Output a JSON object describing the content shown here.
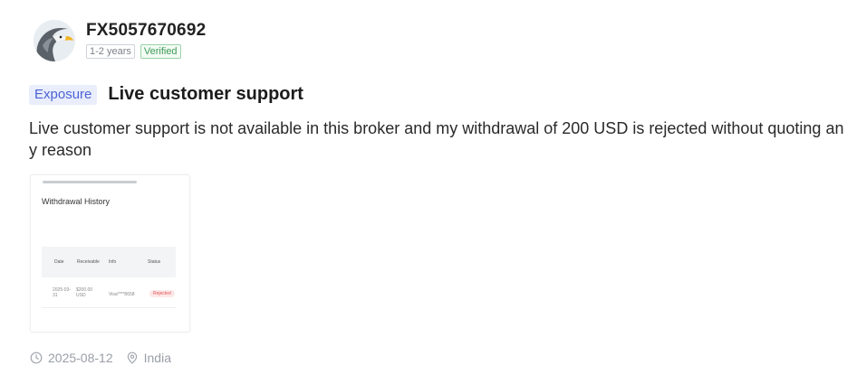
{
  "user": {
    "name": "FX5057670692",
    "experience": "1-2 years",
    "verified": "Verified"
  },
  "post": {
    "tag": "Exposure",
    "title": "Live customer support",
    "body": "Live customer support is not available in this broker and my withdrawal of 200 USD is rejected without quoting any reason"
  },
  "attachment": {
    "title": "Withdrawal History",
    "columns": [
      "Date",
      "Receivable",
      "Info",
      "Status"
    ],
    "row": {
      "date": "2025-03-31",
      "receivable": "$200.00 USD",
      "info": "Visa****8658",
      "status": "Rejected"
    }
  },
  "footer": {
    "date": "2025-08-12",
    "location": "India"
  },
  "colors": {
    "tag_bg": "#e9edfc",
    "tag_text": "#4a63d6",
    "verified": "#3f9b57",
    "rejected": "#e05555"
  },
  "icons": {
    "avatar": "eagle-avatar",
    "time": "clock-icon",
    "location": "location-pin-icon"
  }
}
